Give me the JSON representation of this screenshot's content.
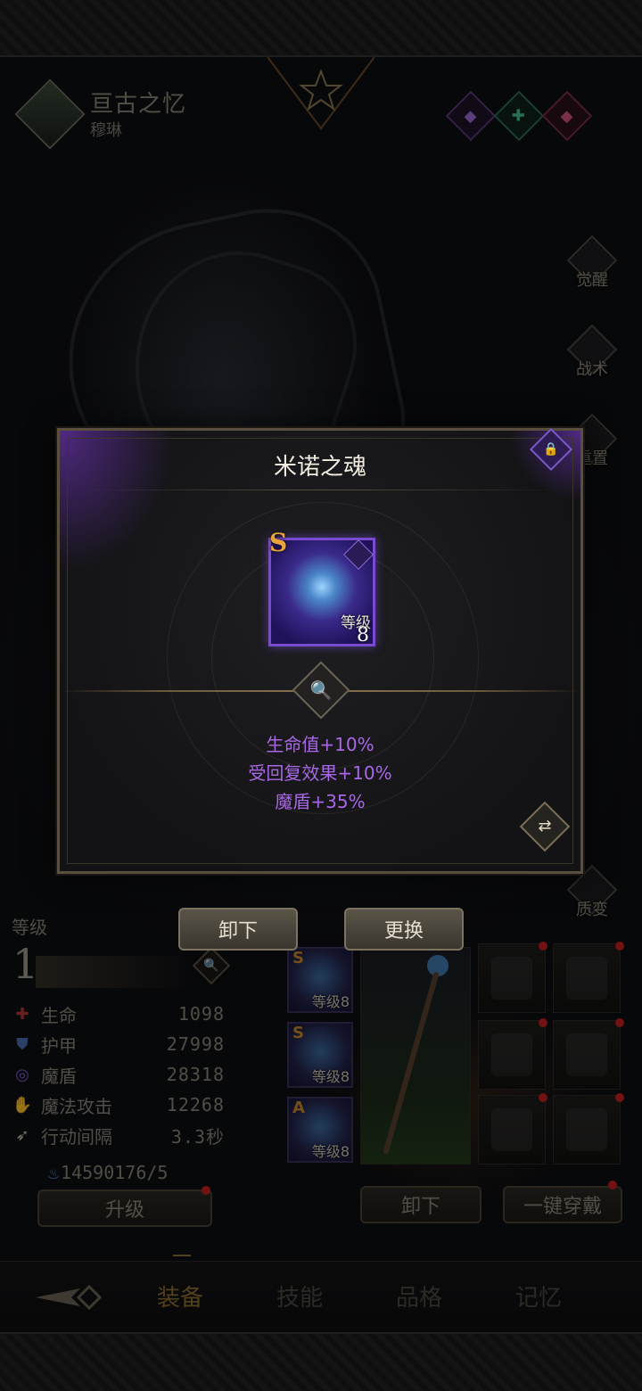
{
  "header": {
    "title": "亘古之忆",
    "subtitle": "穆琳",
    "gems": [
      "purple-gem-icon",
      "green-cross-gem-icon",
      "red-gem-icon"
    ]
  },
  "side_menu": [
    {
      "label": "觉醒",
      "icon": "awaken-icon"
    },
    {
      "label": "战术",
      "icon": "tactics-icon"
    },
    {
      "label": "重置",
      "icon": "reset-icon"
    },
    {
      "label": "质变",
      "icon": "transmute-icon"
    }
  ],
  "modal": {
    "title": "米诺之魂",
    "item": {
      "rank": "S",
      "level_label": "等级",
      "level": "8"
    },
    "attributes": [
      "生命值+10%",
      "受回复效果+10%",
      "魔盾+35%"
    ]
  },
  "hero": {
    "level_label": "等级",
    "level": "1",
    "stats": [
      {
        "name": "生命",
        "value": "1098",
        "icon": "heart-cross-icon",
        "color": "#b23a3a"
      },
      {
        "name": "护甲",
        "value": "27998",
        "icon": "shield-icon",
        "color": "#4a6fb0"
      },
      {
        "name": "魔盾",
        "value": "28318",
        "icon": "swirl-icon",
        "color": "#8a5ad0"
      },
      {
        "name": "魔法攻击",
        "value": "12268",
        "icon": "magic-hand-icon",
        "color": "#8c877a"
      },
      {
        "name": "行动间隔",
        "value": "3.3秒",
        "icon": "wing-icon",
        "color": "#8c877a"
      }
    ],
    "currency": {
      "amount": "14590176",
      "sep": "/5"
    }
  },
  "buttons": {
    "unequip_top": "卸下",
    "replace": "更换",
    "upgrade": "升级",
    "unequip_bottom": "卸下",
    "one_click_equip": "一键穿戴"
  },
  "equip_slots": {
    "minis": [
      {
        "rank": "S",
        "label": "等级8"
      },
      {
        "rank": "S",
        "label": "等级8"
      },
      {
        "rank": "A",
        "label": "等级8"
      }
    ],
    "gear": [
      "helmet-icon",
      "chest-armor-icon",
      "bracer-icon",
      "belt-icon",
      "ring-icon",
      "boots-icon"
    ]
  },
  "tabs": [
    {
      "label": "装备",
      "active": true
    },
    {
      "label": "技能",
      "active": false
    },
    {
      "label": "品格",
      "active": false
    },
    {
      "label": "记忆",
      "active": false
    }
  ]
}
